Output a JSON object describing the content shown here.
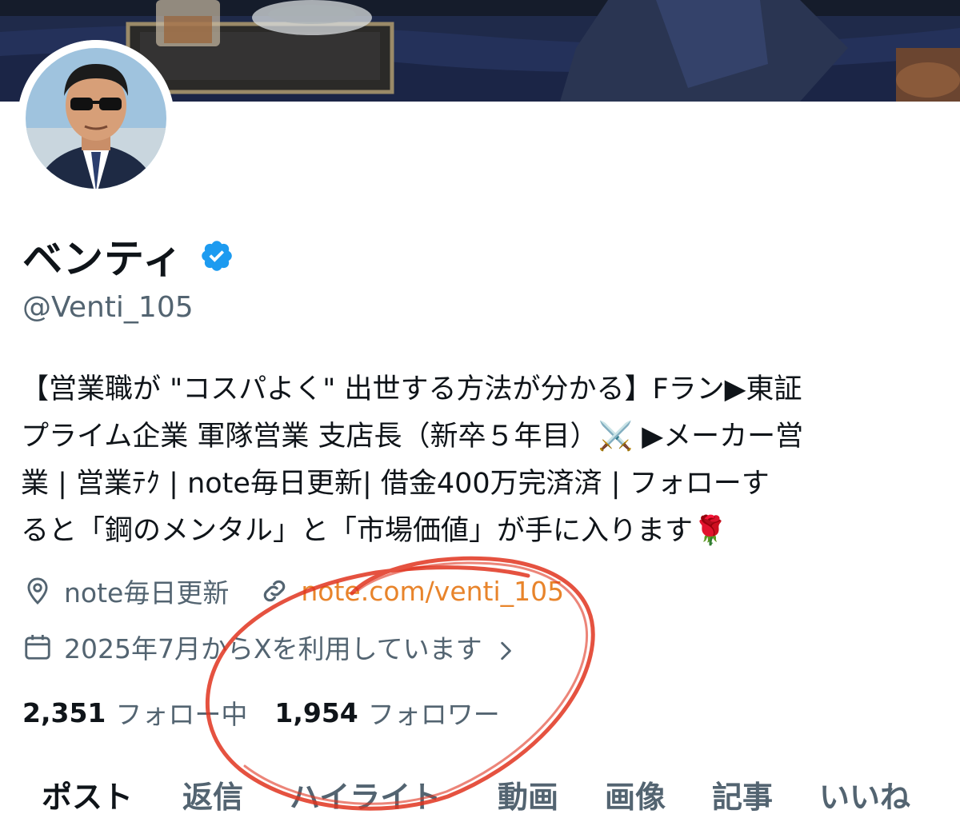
{
  "profile": {
    "display_name": "ベンティ",
    "handle": "@Venti_105",
    "verified_icon": "verified-badge-icon",
    "bio_lines": [
      "【営業職が \"コスパよく\" 出世する方法が分かる】Fラン▶東証",
      "プライム企業 軍隊営業 支店長（新卒５年目）⚔️ ▶メーカー営",
      "業 | 営業ﾃｸ | note毎日更新| 借金400万完済済 | フォローす",
      "ると「鋼のメンタル」と「市場価値」が手に入ります🌹"
    ],
    "location": "note毎日更新",
    "website": "note.com/venti_105",
    "joined": "2025年7月からXを利用しています",
    "following_count": "2,351",
    "following_label": "フォロー中",
    "followers_count": "1,954",
    "followers_label": "フォロワー"
  },
  "tabs": [
    {
      "label": "ポスト",
      "active": true
    },
    {
      "label": "返信",
      "active": false
    },
    {
      "label": "ハイライト",
      "active": false
    },
    {
      "label": "動画",
      "active": false
    },
    {
      "label": "画像",
      "active": false
    },
    {
      "label": "記事",
      "active": false
    },
    {
      "label": "いいね",
      "active": false
    }
  ],
  "colors": {
    "text_primary": "#0f1419",
    "text_secondary": "#536471",
    "link": "#e8842b",
    "verified": "#1d9bf0",
    "annotation": "#e0341f"
  }
}
